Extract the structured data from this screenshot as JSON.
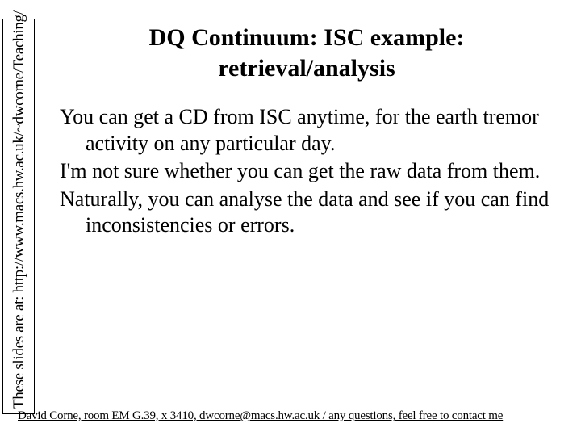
{
  "sideNote": "These slides are at: http://www.macs.hw.ac.uk/~dwcorne/Teaching/",
  "title": "DQ Continuum: ISC example:\nretrieval/analysis",
  "body": {
    "p1": "You can get a CD from ISC anytime, for the earth tremor activity on any particular day.",
    "p2": "I'm not sure whether you can get the raw data from them.",
    "p3": "Naturally, you can analyse the data and see if you can find inconsistencies or errors."
  },
  "footer": "David Corne, room EM G.39, x 3410, dwcorne@macs.hw.ac.uk / any questions, feel free to contact me"
}
